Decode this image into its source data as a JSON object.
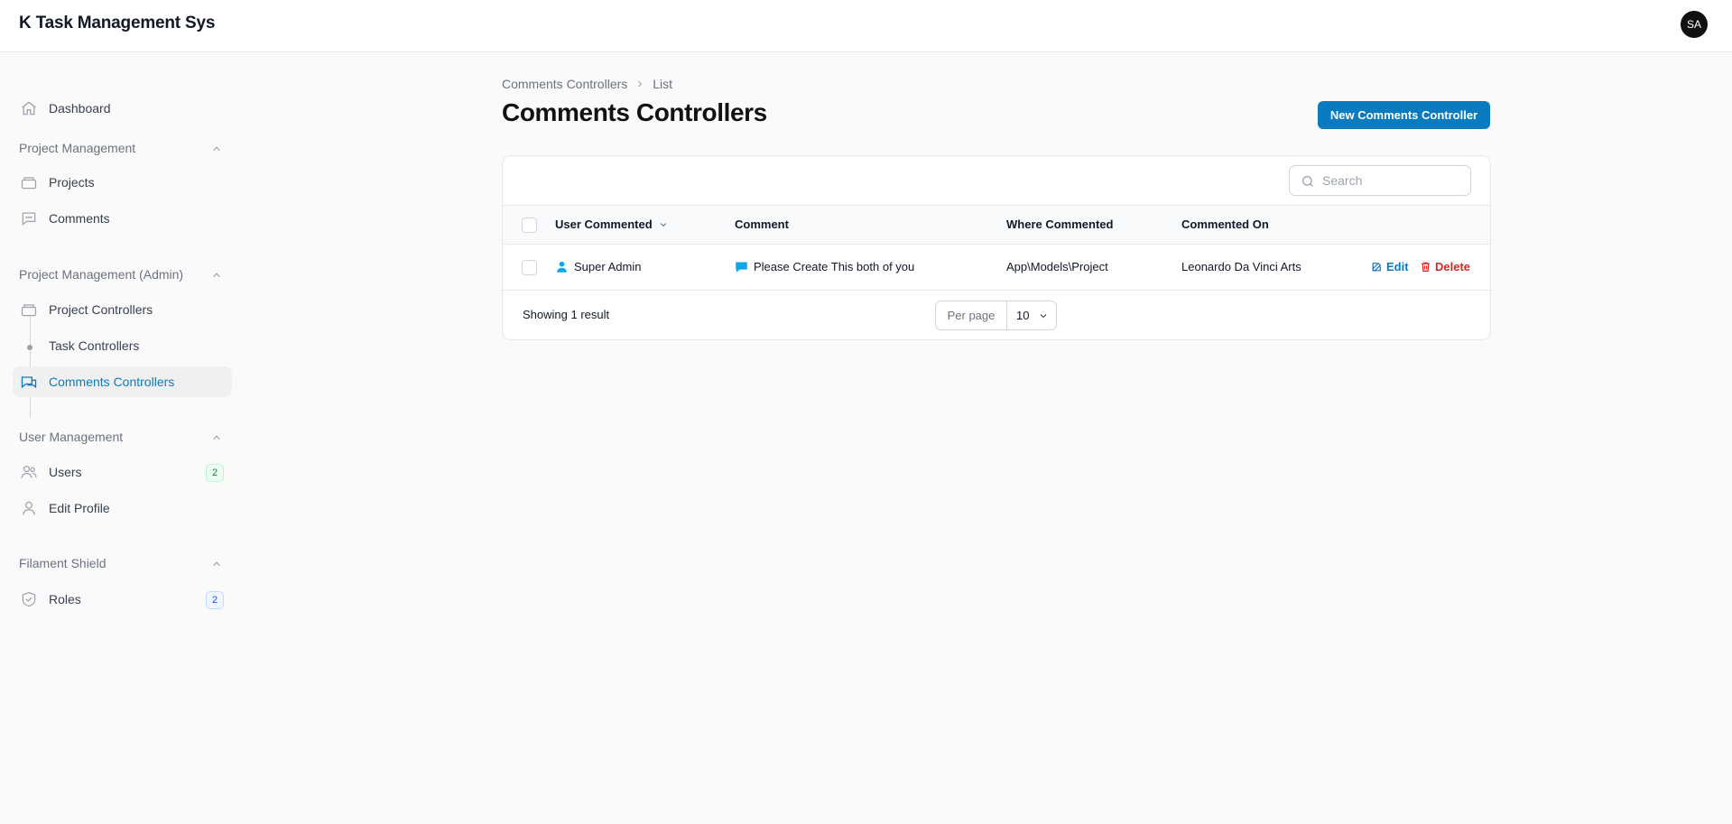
{
  "app": {
    "title": "K Task Management Sys",
    "avatar_initials": "SA"
  },
  "sidebar": {
    "dashboard": "Dashboard",
    "groups": [
      {
        "label": "Project Management",
        "items": [
          "Projects",
          "Comments"
        ]
      },
      {
        "label": "Project Management (Admin)",
        "items": [
          "Project Controllers",
          "Task Controllers",
          "Comments Controllers"
        ]
      },
      {
        "label": "User Management",
        "items": [
          "Users",
          "Edit Profile"
        ],
        "users_badge": "2"
      },
      {
        "label": "Filament Shield",
        "items": [
          "Roles"
        ],
        "roles_badge": "2"
      }
    ],
    "active_item": "Comments Controllers"
  },
  "breadcrumb": {
    "parent": "Comments Controllers",
    "current": "List"
  },
  "page": {
    "title": "Comments Controllers",
    "new_button": "New Comments Controller"
  },
  "table": {
    "search_placeholder": "Search",
    "columns": [
      "User Commented",
      "Comment",
      "Where Commented",
      "Commented On"
    ],
    "rows": [
      {
        "user": "Super Admin",
        "comment": "Please Create This both of you",
        "where": "App\\Models\\Project",
        "on": "Leonardo Da Vinci Arts",
        "edit": "Edit",
        "delete": "Delete"
      }
    ],
    "footer": {
      "showing": "Showing 1 result",
      "per_page_label": "Per page",
      "per_page_value": "10"
    }
  },
  "colors": {
    "primary": "#0a7bbf",
    "danger": "#dc2626",
    "info": "#0ea5e9"
  }
}
